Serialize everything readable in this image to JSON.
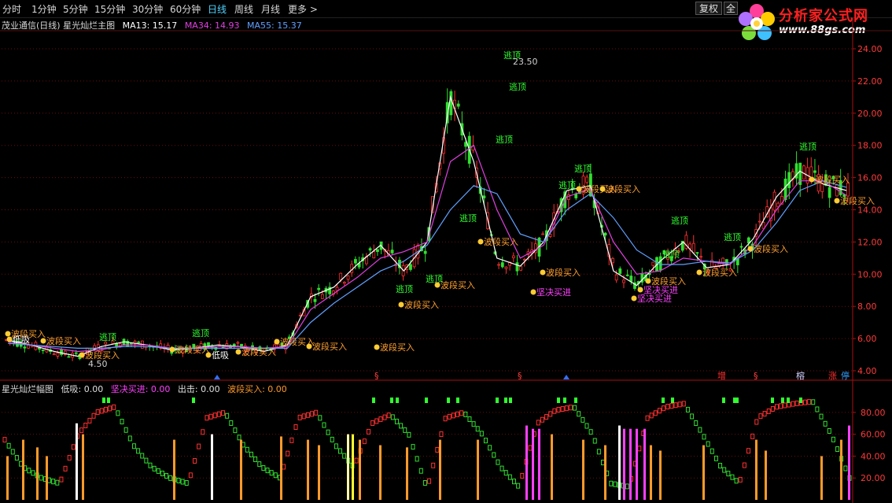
{
  "toolbar": {
    "timeframes": [
      {
        "label": "分时",
        "active": false
      },
      {
        "label": "1分钟",
        "active": false
      },
      {
        "label": "5分钟",
        "active": false
      },
      {
        "label": "15分钟",
        "active": false
      },
      {
        "label": "30分钟",
        "active": false
      },
      {
        "label": "60分钟",
        "active": false
      },
      {
        "label": "日线",
        "active": true
      },
      {
        "label": "周线",
        "active": false
      },
      {
        "label": "月线",
        "active": false
      }
    ],
    "more_label": "更多 >",
    "restore_label": "复权",
    "extra_label": "全"
  },
  "logo": {
    "text": "分析家公式网",
    "url": "www.88gs.com"
  },
  "main_chart": {
    "title": "茂业通信(日线) 星光灿烂主图",
    "ma13_label": "MA13: 15.17",
    "ma34_label": "MA34: 14.93",
    "ma55_label": "MA55: 15.37",
    "colors": {
      "ma13": "#ffffff",
      "ma34": "#e040e0",
      "ma55": "#60a0ff"
    },
    "y_ticks": [
      "24.00",
      "22.00",
      "20.00",
      "18.00",
      "16.00",
      "14.00",
      "12.00",
      "10.00",
      "8.00",
      "6.00",
      "4.00"
    ],
    "high_label": "23.50",
    "low_label": "4.50"
  },
  "chart_data": [
    {
      "type": "line",
      "title": "茂业通信(日线) 星光灿烂主图",
      "ylim": [
        4,
        24
      ],
      "series": [
        {
          "name": "MA13",
          "values": [
            5.9,
            5.6,
            5.2,
            4.9,
            5.5,
            5.8,
            5.6,
            5.3,
            5.4,
            5.6,
            5.5,
            5.2,
            5.6,
            8.6,
            9.2,
            10.6,
            11.8,
            10.2,
            12.0,
            21.0,
            17.0,
            11.0,
            10.5,
            12.0,
            15.2,
            15.5,
            10.2,
            9.3,
            10.8,
            12.0,
            10.4,
            10.6,
            12.2,
            14.8,
            16.4,
            15.6,
            15.2
          ]
        },
        {
          "name": "MA34",
          "values": [
            5.8,
            5.6,
            5.4,
            5.2,
            5.3,
            5.6,
            5.6,
            5.4,
            5.4,
            5.5,
            5.5,
            5.4,
            5.5,
            7.8,
            8.8,
            9.8,
            11.0,
            11.4,
            12.0,
            17.0,
            18.0,
            14.0,
            11.0,
            11.8,
            14.8,
            15.3,
            12.0,
            10.0,
            10.2,
            11.0,
            10.8,
            10.6,
            11.8,
            14.0,
            15.8,
            15.8,
            14.9
          ]
        },
        {
          "name": "MA55",
          "values": [
            5.7,
            5.6,
            5.5,
            5.4,
            5.4,
            5.5,
            5.5,
            5.4,
            5.4,
            5.4,
            5.4,
            5.4,
            5.4,
            7.0,
            8.2,
            9.2,
            10.2,
            10.8,
            11.8,
            14.0,
            15.5,
            15.0,
            12.5,
            12.0,
            14.0,
            15.0,
            13.5,
            11.5,
            10.6,
            10.6,
            10.8,
            10.7,
            11.5,
            13.2,
            15.2,
            15.8,
            15.4
          ]
        }
      ]
    },
    {
      "type": "bar",
      "title": "星光灿烂幅图",
      "ylim": [
        0,
        100
      ],
      "y_ticks": [
        "80.00",
        "60.00",
        "40.00",
        "20.00"
      ],
      "series": [
        {
          "name": "STAR",
          "values": [
            55,
            30,
            20,
            15,
            60,
            80,
            85,
            50,
            30,
            20,
            15,
            75,
            80,
            50,
            30,
            20,
            75,
            80,
            50,
            30,
            70,
            78,
            60,
            10,
            75,
            80,
            60,
            30,
            12,
            70,
            82,
            85,
            60,
            15,
            12,
            75,
            85,
            88,
            60,
            30,
            15,
            75,
            85,
            88,
            90,
            60,
            20
          ]
        }
      ]
    }
  ],
  "sub_chart": {
    "title": "星光灿烂幅图",
    "low_absorb_label": "低吸: 0.00",
    "firm_buy_label": "坚决买进: 0.00",
    "exit_label": "出击: 0.00",
    "wave_buy_label": "波段买入: 0.00",
    "colors": {
      "firm_buy": "#ff40ff",
      "wave_buy": "#ff9a2a",
      "low_absorb": "#ffffff",
      "exit": "#e0e0e0"
    }
  },
  "annotations": {
    "escape_top": "逃顶",
    "wave_buy": "波段买入",
    "low_absorb": "低吸",
    "firm_buy": "坚决买进"
  },
  "markers": {
    "zeng": "增",
    "rong": "榕",
    "zhang": "涨",
    "ting": "停"
  }
}
